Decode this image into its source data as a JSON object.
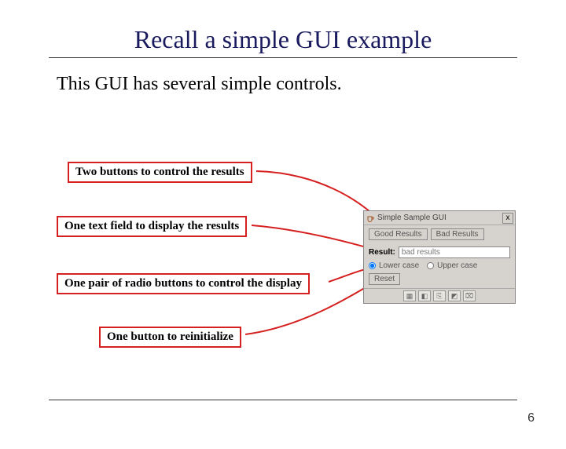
{
  "title": "Recall a simple GUI example",
  "subtitle": "This GUI has several simple controls.",
  "annotations": {
    "a1": "Two buttons to control the results",
    "a2": "One text field to display the results",
    "a3": "One pair of radio buttons to control the display",
    "a4": "One button to reinitialize"
  },
  "gui": {
    "window_title": "Simple Sample GUI",
    "close_label": "x",
    "btn_good": "Good Results",
    "btn_bad": "Bad Results",
    "result_label": "Result:",
    "result_value": "bad results",
    "radio_lower": "Lower case",
    "radio_upper": "Upper case",
    "btn_reset": "Reset"
  },
  "page_number": "6"
}
